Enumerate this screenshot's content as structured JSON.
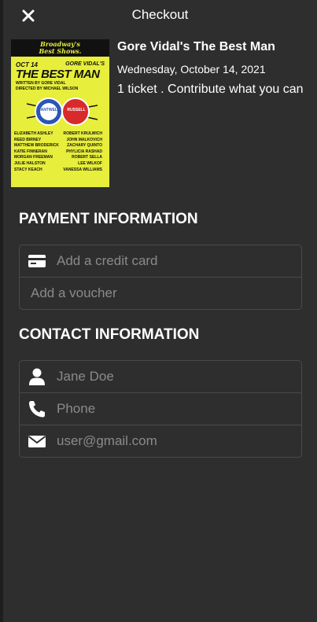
{
  "header": {
    "title": "Checkout",
    "close_icon": "close-icon"
  },
  "event": {
    "title": "Gore Vidal's The Best Man",
    "date": "Wednesday, October 14, 2021",
    "tickets": "1 ticket . Contribute what you can",
    "poster": {
      "brand_line1": "Broadway's",
      "brand_line2": "Best Shows.",
      "date": "OCT 14",
      "author": "GORE VIDAL'S",
      "title": "THE BEST MAN",
      "written_by": "WRITTEN BY GORE VIDAL",
      "directed_by": "DIRECTED BY MICHAEL WILSON",
      "button_left": "CANTWELL",
      "button_right": "RUSSELL",
      "cast_left": [
        "ELIZABETH ASHLEY",
        "REED BIRNEY",
        "MATTHEW BRODERICK",
        "KATIE FINNERAN",
        "MORGAN FREEMAN",
        "JULIE HALSTON",
        "STACY KEACH"
      ],
      "cast_right": [
        "ROBERT KRULWICH",
        "JOHN MALKOVICH",
        "ZACHARY QUINTO",
        "PHYLICIA RASHAD",
        "ROBERT SELLA",
        "LEE WILKOF",
        "VANESSA WILLIAMS"
      ]
    }
  },
  "payment": {
    "heading": "PAYMENT INFORMATION",
    "credit_card_placeholder": "Add a credit card",
    "voucher_placeholder": "Add a voucher"
  },
  "contact": {
    "heading": "CONTACT INFORMATION",
    "name_placeholder": "Jane Doe",
    "phone_placeholder": "Phone",
    "email_placeholder": "user@gmail.com"
  },
  "colors": {
    "background": "#2e2e2e",
    "poster_yellow": "#e7ee3b",
    "placeholder": "#8a8a8a",
    "border": "#4a4a4a"
  }
}
